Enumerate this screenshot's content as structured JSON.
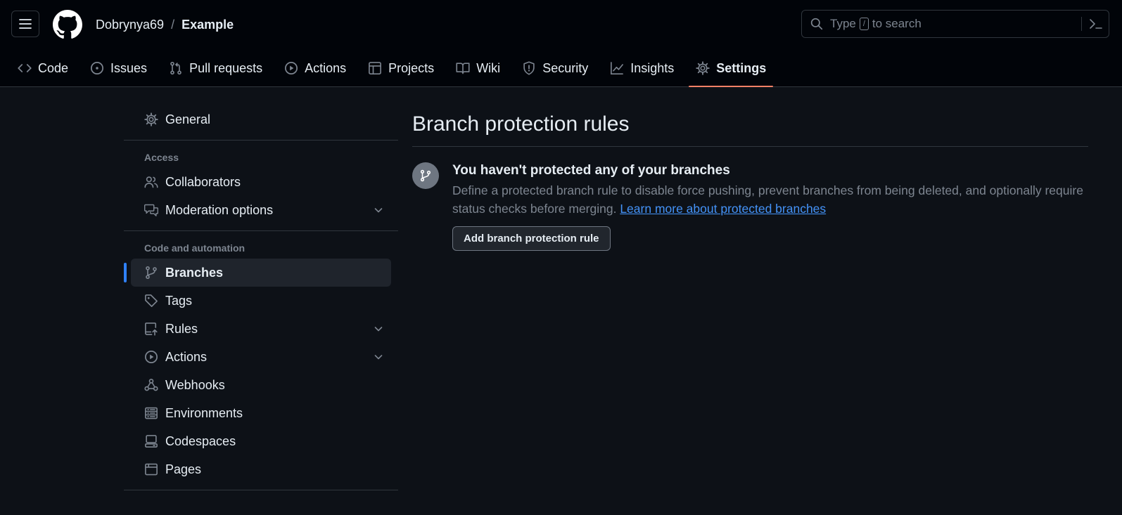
{
  "header": {
    "owner": "Dobrynya69",
    "separator": "/",
    "repo": "Example",
    "search": {
      "placeholder_before": "Type",
      "key": "/",
      "placeholder_after": "to search"
    }
  },
  "tabs": [
    {
      "label": "Code",
      "icon": "code-icon"
    },
    {
      "label": "Issues",
      "icon": "issue-opened-icon"
    },
    {
      "label": "Pull requests",
      "icon": "git-pull-request-icon"
    },
    {
      "label": "Actions",
      "icon": "play-icon"
    },
    {
      "label": "Projects",
      "icon": "table-icon"
    },
    {
      "label": "Wiki",
      "icon": "book-icon"
    },
    {
      "label": "Security",
      "icon": "shield-icon"
    },
    {
      "label": "Insights",
      "icon": "graph-icon"
    },
    {
      "label": "Settings",
      "icon": "gear-icon",
      "active": true
    }
  ],
  "sidebar": {
    "general": "General",
    "access_heading": "Access",
    "access_items": [
      {
        "label": "Collaborators",
        "icon": "people-icon"
      },
      {
        "label": "Moderation options",
        "icon": "comment-discussion-icon",
        "expandable": true
      }
    ],
    "automation_heading": "Code and automation",
    "automation_items": [
      {
        "label": "Branches",
        "icon": "git-branch-icon",
        "active": true
      },
      {
        "label": "Tags",
        "icon": "tag-icon"
      },
      {
        "label": "Rules",
        "icon": "repo-push-icon",
        "expandable": true
      },
      {
        "label": "Actions",
        "icon": "play-icon",
        "expandable": true
      },
      {
        "label": "Webhooks",
        "icon": "webhook-icon"
      },
      {
        "label": "Environments",
        "icon": "server-icon"
      },
      {
        "label": "Codespaces",
        "icon": "codespaces-icon"
      },
      {
        "label": "Pages",
        "icon": "browser-icon"
      }
    ]
  },
  "main": {
    "title": "Branch protection rules",
    "blankslate": {
      "heading": "You haven't protected any of your branches",
      "description": "Define a protected branch rule to disable force pushing, prevent branches from being deleted, and optionally require status checks before merging.",
      "link": "Learn more about protected branches",
      "button": "Add branch protection rule"
    }
  },
  "colors": {
    "accent": "#2f81f7",
    "tab_underline": "#f78166",
    "link": "#4493f8",
    "background": "#0d1117",
    "header_background": "#010409"
  }
}
